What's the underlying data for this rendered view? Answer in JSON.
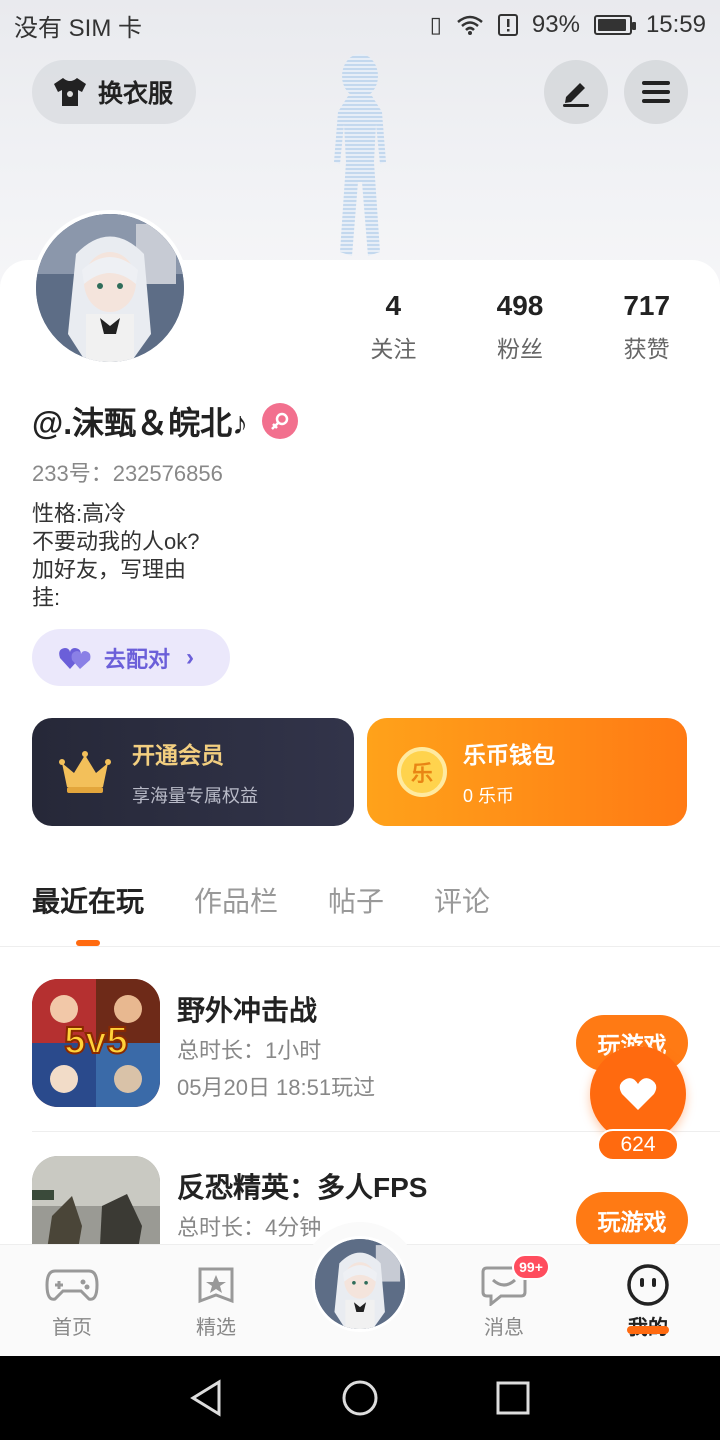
{
  "status_bar": {
    "carrier": "没有 SIM 卡",
    "battery": "93%",
    "battery_level": 0.93,
    "time": "15:59"
  },
  "header": {
    "outfit_label": "换衣服"
  },
  "profile": {
    "stats": [
      {
        "value": "4",
        "label": "关注"
      },
      {
        "value": "498",
        "label": "粉丝"
      },
      {
        "value": "717",
        "label": "获赞"
      }
    ],
    "username": "@.沫甄＆皖北♪",
    "uid": "233号：232576856",
    "bio": [
      "性格:高冷",
      "不要动我的人ok?",
      "加好友，写理由",
      "挂:"
    ],
    "match_label": "去配对"
  },
  "vip": {
    "title": "开通会员",
    "subtitle": "享海量专属权益"
  },
  "wallet": {
    "title": "乐币钱包",
    "subtitle": "0 乐币",
    "coin_glyph": "乐"
  },
  "tabs": [
    "最近在玩",
    "作品栏",
    "帖子",
    "评论"
  ],
  "games": [
    {
      "title": "野外冲击战",
      "duration": "总时长：1小时",
      "last_played": "05月20日 18:51玩过",
      "icon_text": "5v5",
      "button": "玩游戏"
    },
    {
      "title": "反恐精英：多人FPS",
      "duration": "总时长：4分钟",
      "button": "玩游戏"
    }
  ],
  "like_count": "624",
  "bottom_nav": {
    "items": [
      {
        "label": "首页",
        "icon": "gamepad-icon"
      },
      {
        "label": "精选",
        "icon": "star-icon"
      },
      {
        "label": "消息",
        "icon": "message-icon"
      },
      {
        "label": "我的",
        "icon": "face-icon"
      }
    ],
    "badge": "99+"
  },
  "colors": {
    "accent": "#ff6a10",
    "vip_bg": "#262838",
    "wallet": "#ff8c16",
    "gender": "#f2708e"
  }
}
